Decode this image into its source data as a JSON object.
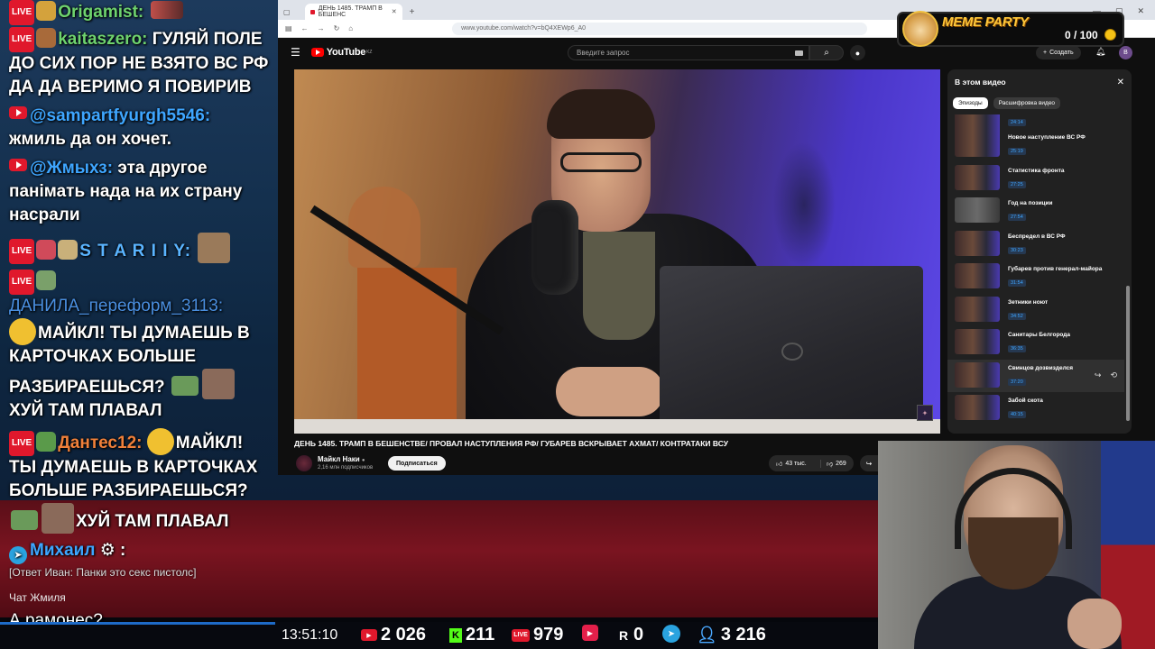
{
  "chat": {
    "messages": [
      {
        "nick": "Origamist:",
        "text": ""
      },
      {
        "nick": "kaitaszero:",
        "text": "ГУЛЯЙ ПОЛЕ ДО СИХ ПОР НЕ ВЗЯТО ВС РФ ДА ДА ВЕРИМО Я ПОВИРИВ"
      },
      {
        "nick": "@sampartfyurgh5546:",
        "text": "жмиль да он хочет."
      },
      {
        "nick": "@Жмыхз:",
        "text": "эта другое панімать нада на их страну насрали"
      },
      {
        "nick": "S T A R I I Y:",
        "text": ""
      },
      {
        "nick": "ДАНИЛА_переформ_3113:",
        "text1": "МАЙКЛ! ТЫ ДУМАЕШЬ В КАРТОЧКАХ БОЛЬШЕ РАЗБИРАЕШЬСЯ?",
        "text2": "ХУЙ ТАМ ПЛАВАЛ"
      },
      {
        "nick": "Дантес12:",
        "text1": "МАЙКЛ! ТЫ ДУМАЕШЬ В КАРТОЧКАХ БОЛЬШЕ РАЗБИРАЕШЬСЯ?",
        "text2": "ХУЙ ТАМ ПЛАВАЛ"
      },
      {
        "nick": "Михаил",
        "text": ":"
      }
    ],
    "reply": "[Ответ Иван: Панки это секс пистолс]",
    "chat_label": "Чат Жмиля",
    "last_msg": "А рамонес?"
  },
  "browser": {
    "tab_title": "ДЕНЬ 1485. ТРАМП В БЕШЕНС",
    "url": "www.youtube.com/watch?v=bQ4XEWp6_A0",
    "yt_logo": "YouTube",
    "yt_region": "KZ",
    "search_placeholder": "Введите запрос",
    "create_label": "Создать",
    "avatar_letter": "В"
  },
  "video": {
    "title": "ДЕНЬ 1485. ТРАМП В БЕШЕНСТВЕ/ ПРОВАЛ НАСТУПЛЕНИЯ РФ/ ГУБАРЕВ ВСКРЫВАЕТ АХМАТ/ КОНТРАТАКИ ВСУ",
    "channel": "Майкл Наки",
    "subs": "2,16 млн подписчиков",
    "subscribe": "Подписаться",
    "likes": "43 тыс.",
    "dislikes": "269"
  },
  "chapters": {
    "heading": "В этом видео",
    "tab_episodes": "Эпизоды",
    "tab_transcript": "Расшифровка видео",
    "items": [
      {
        "title": "",
        "time": "24:14"
      },
      {
        "title": "Новое наступление ВС РФ",
        "time": "25:19"
      },
      {
        "title": "Статистика фронта",
        "time": "27:25"
      },
      {
        "title": "Год на позиции",
        "time": "27:54"
      },
      {
        "title": "Беспредел в ВС РФ",
        "time": "30:23"
      },
      {
        "title": "Губарев против генерал-майора",
        "time": "31:54"
      },
      {
        "title": "Зетники ноют",
        "time": "34:52"
      },
      {
        "title": "Санитары Белгорода",
        "time": "36:35"
      },
      {
        "title": "Свинцов дозвизделся",
        "time": "37:20"
      },
      {
        "title": "Забой скота",
        "time": "40:15"
      }
    ]
  },
  "meme_party": {
    "title": "MEME PARTY",
    "count": "0 / 100"
  },
  "stats": {
    "time": "13:51:10",
    "youtube": "2 026",
    "kick": "211",
    "vk_live": "979",
    "vk_video": "",
    "rutube": "0",
    "telegram": "",
    "viewers": "3 216",
    "kick_letter": "K",
    "rutube_letter": "R",
    "live_badge": "LIVE"
  }
}
